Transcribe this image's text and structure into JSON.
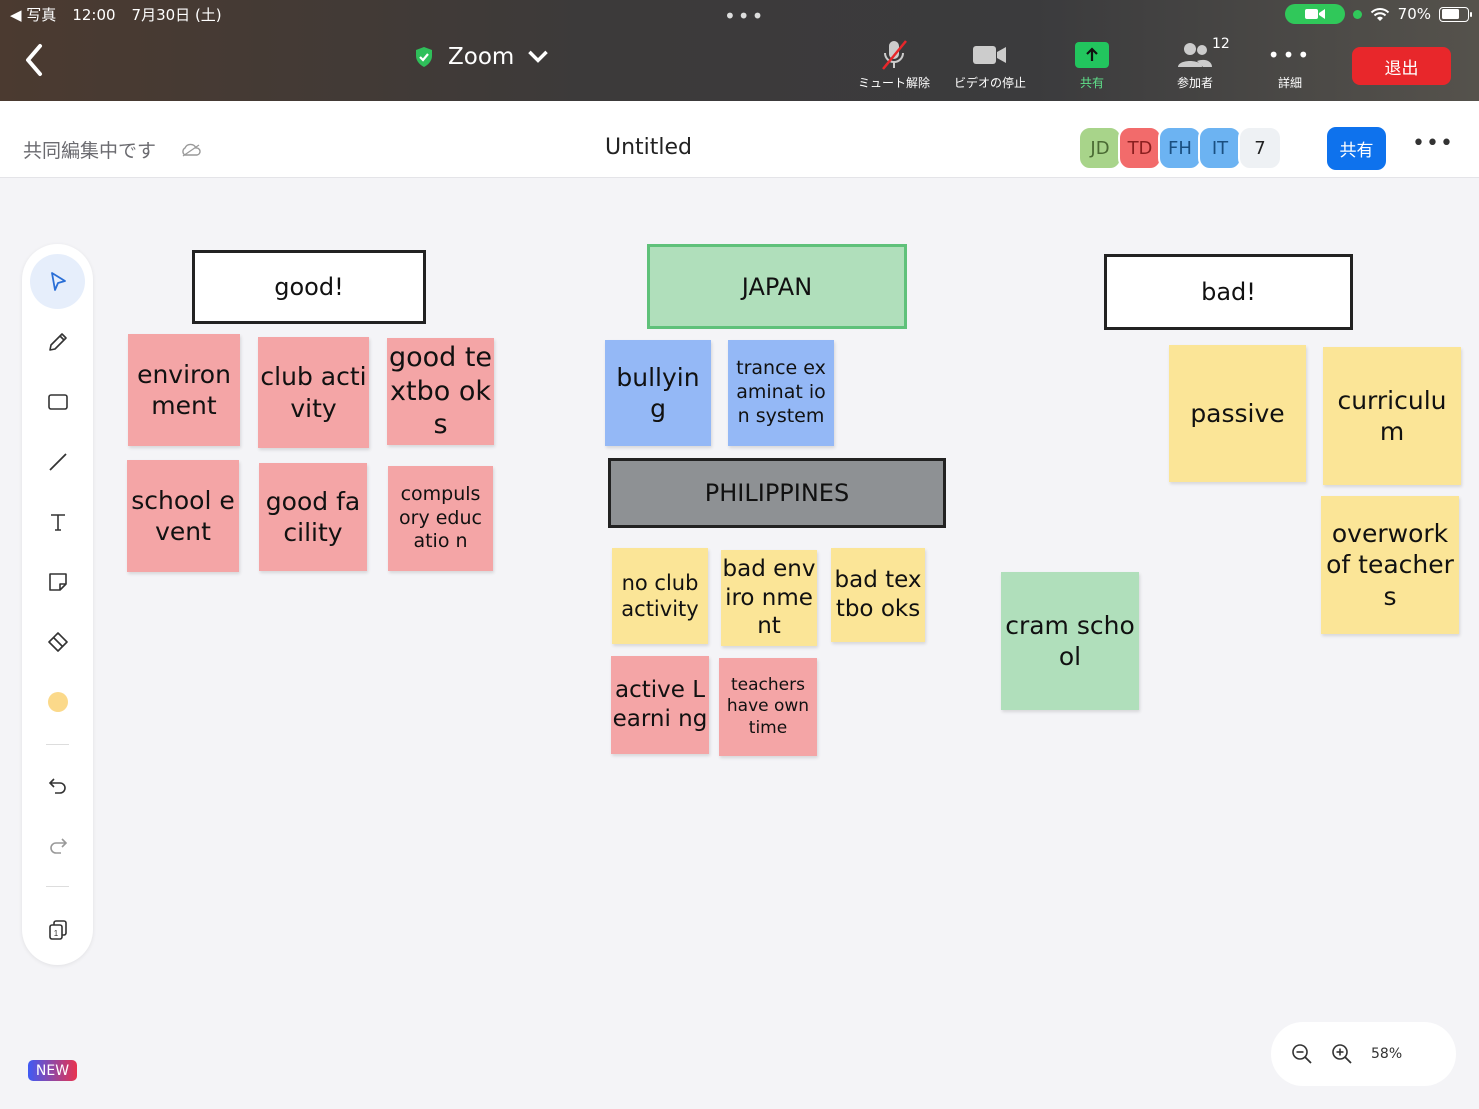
{
  "status_bar": {
    "back_app": "◀ 写真",
    "time": "12:00",
    "date": "7月30日 (土)",
    "battery": "70%"
  },
  "toolbar": {
    "meeting_name": "Zoom",
    "mute_label": "ミュート解除",
    "video_label": "ビデオの停止",
    "share_label": "共有",
    "participants_label": "参加者",
    "participants_count": "12",
    "more_label": "詳細",
    "exit_label": "退出",
    "accent_green": "#22c55e",
    "exit_color": "#e8272b"
  },
  "whiteboard": {
    "status": "共同編集中です",
    "title": "Untitled",
    "avatars": [
      {
        "initials": "JD",
        "color": "#a8d48a",
        "text_color": "#4a6a33"
      },
      {
        "initials": "TD",
        "color": "#f26b6b",
        "text_color": "#8a1f1f"
      },
      {
        "initials": "FH",
        "color": "#6cb3f2",
        "text_color": "#1a4f80"
      },
      {
        "initials": "IT",
        "color": "#6cb3f2",
        "text_color": "#1a4f80"
      }
    ],
    "extra_count": "7",
    "share_label": "共有",
    "share_color": "#0e72ed",
    "more_icon": "•••"
  },
  "tools": [
    "select-icon",
    "pen-icon",
    "rectangle-icon",
    "line-icon",
    "text-icon",
    "sticky-note-icon",
    "eraser-icon",
    "color-swatch",
    "undo-icon",
    "redo-icon",
    "pages-icon"
  ],
  "canvas": {
    "frames": {
      "good": "good!",
      "japan": "JAPAN",
      "bad": "bad!",
      "philippines": "PHILIPPINES"
    },
    "notes": {
      "environment": "environ ment",
      "club_activity": "club activity",
      "good_textbooks": "good textbo oks",
      "school_event": "school event",
      "good_facility": "good facility",
      "compulsory": "compuls ory educatio n",
      "bullying": "bullyin g",
      "trance": "trance examinat ion system",
      "no_club": "no club activity",
      "bad_env": "bad enviro nment",
      "bad_textbooks": "bad textbo oks",
      "active_learning": "active Learni ng",
      "teachers_time": "teachers have own time",
      "cram_school": "cram school",
      "passive": "passive",
      "curriculum": "curriculu m",
      "overwork": "overwork of teachers"
    },
    "note_colors": {
      "pink": "#f4a5a6",
      "yellow": "#fbe597",
      "blue": "#94b8f6",
      "green": "#b0dfbb"
    }
  },
  "zoom_control": {
    "level": "58%"
  },
  "badge": "NEW"
}
